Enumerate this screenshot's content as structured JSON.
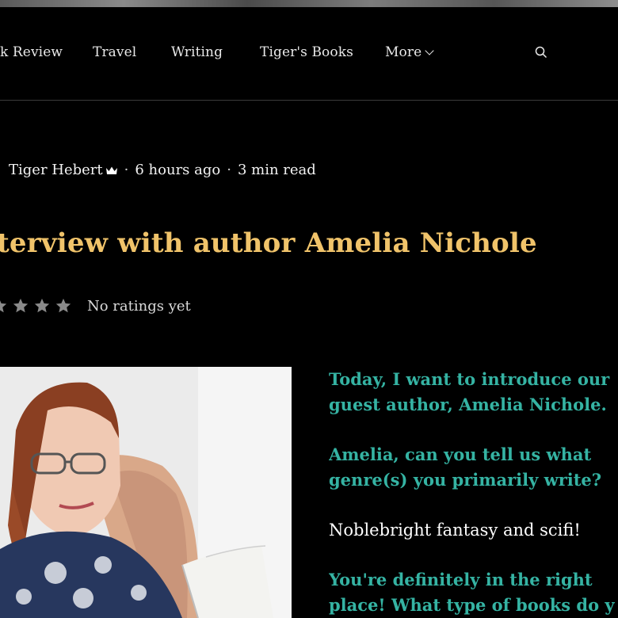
{
  "nav": {
    "items": [
      "k Review",
      "Travel",
      "Writing",
      "Tiger's Books"
    ],
    "more_label": "More"
  },
  "post": {
    "author": "Tiger Hebert",
    "time_ago": "6 hours ago",
    "read_time": "3 min read",
    "title": "terview with author Amelia Nichole",
    "rating_text": "No ratings yet",
    "rating_value": 0
  },
  "article": {
    "paragraphs": [
      {
        "style": "question",
        "lines": [
          "Today, I want to introduce our",
          "guest author, Amelia Nichole."
        ]
      },
      {
        "style": "question",
        "lines": [
          "Amelia, can you tell us what",
          "genre(s) you primarily write?"
        ]
      },
      {
        "style": "answer",
        "lines": [
          "Noblebright fantasy and scifi!"
        ]
      },
      {
        "style": "question",
        "lines": [
          "You're definitely in the right",
          "place! What type of books do y"
        ]
      }
    ]
  },
  "colors": {
    "accent_title": "#f0c36a",
    "question_text": "#35b3a3",
    "background": "#000000"
  },
  "icons": [
    "search-icon",
    "crown-icon",
    "star-icon",
    "chevron-down-icon"
  ]
}
